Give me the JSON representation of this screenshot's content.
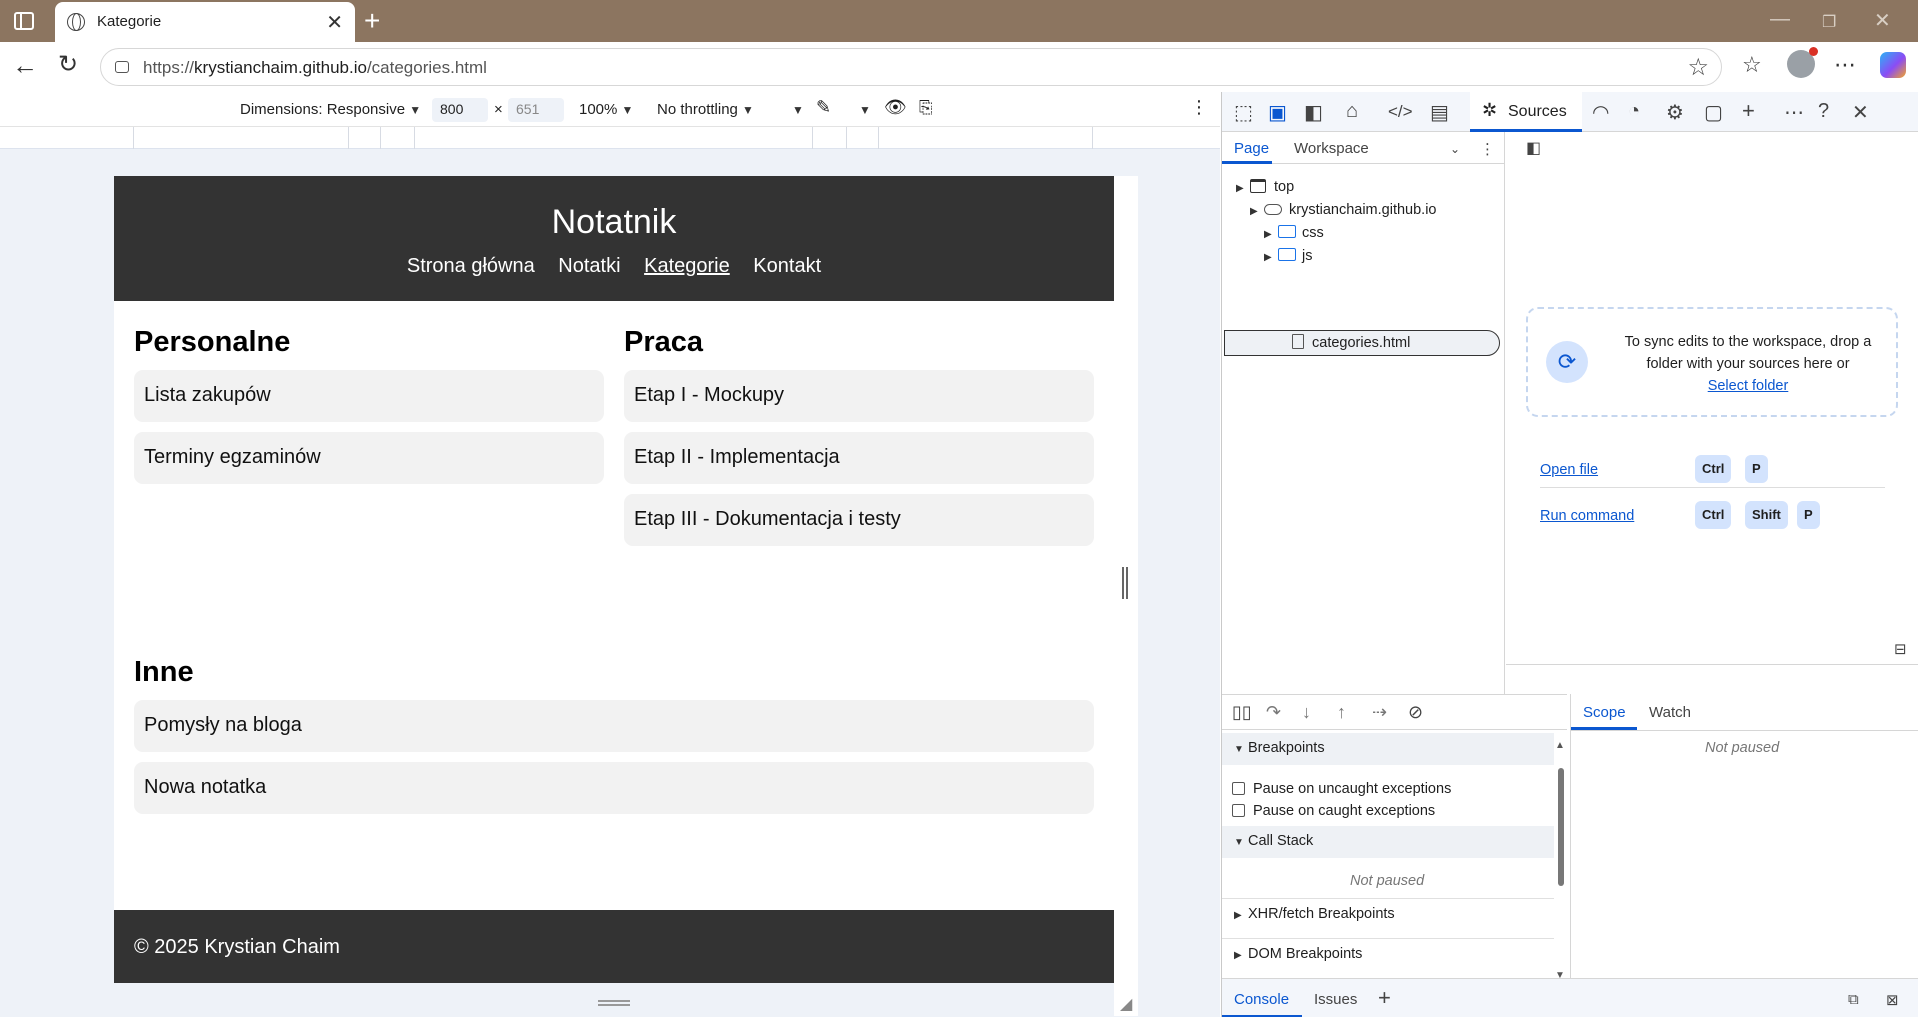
{
  "browser": {
    "tab_title": "Kategorie",
    "url_prefix": "https://",
    "url_host": "krystianchaim.github.io",
    "url_path": "/categories.html"
  },
  "device_toolbar": {
    "dimensions_label": "Dimensions: Responsive",
    "width": "800",
    "height": "651",
    "times": "×",
    "zoom": "100%",
    "throttling": "No throttling"
  },
  "site": {
    "title": "Notatnik",
    "nav": [
      "Strona główna",
      "Notatki",
      "Kategorie",
      "Kontakt"
    ],
    "active_nav": "Kategorie",
    "sections": [
      {
        "title": "Personalne",
        "notes": [
          "Lista zakupów",
          "Terminy egzaminów"
        ]
      },
      {
        "title": "Praca",
        "notes": [
          "Etap I - Mockupy",
          "Etap II - Implementacja",
          "Etap III - Dokumentacja i testy"
        ]
      },
      {
        "title": "Inne",
        "notes": [
          "Pomysły na bloga",
          "Nowa notatka"
        ]
      }
    ],
    "footer": "© 2025 Krystian Chaim"
  },
  "devtools": {
    "active_panel": "Sources",
    "nav_tabs": [
      "Page",
      "Workspace"
    ],
    "tree": {
      "top": "top",
      "host": "krystianchaim.github.io",
      "folders": [
        "css",
        "js"
      ],
      "file": "categories.html"
    },
    "workspace_hint": "To sync edits to the workspace, drop a folder with your sources here or",
    "select_folder": "Select folder",
    "open_file": "Open file",
    "run_command": "Run command",
    "keys": {
      "ctrl": "Ctrl",
      "shift": "Shift",
      "p": "P"
    },
    "breakpoints": "Breakpoints",
    "pause_uncaught": "Pause on uncaught exceptions",
    "pause_caught": "Pause on caught exceptions",
    "call_stack": "Call Stack",
    "not_paused": "Not paused",
    "xhr_breakpoints": "XHR/fetch Breakpoints",
    "dom_breakpoints": "DOM Breakpoints",
    "scope_tabs": [
      "Scope",
      "Watch"
    ],
    "drawer_tabs": [
      "Console",
      "Issues"
    ]
  }
}
